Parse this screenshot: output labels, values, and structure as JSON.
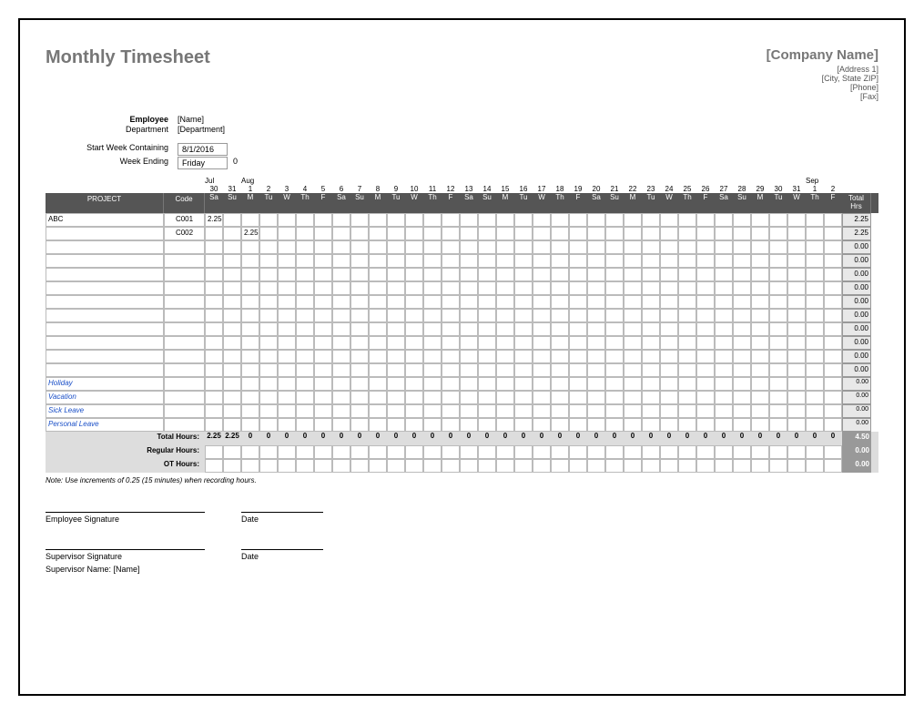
{
  "title": "Monthly Timesheet",
  "company": {
    "name": "[Company Name]",
    "address1": "[Address 1]",
    "city_state_zip": "[City, State ZIP]",
    "phone": "[Phone]",
    "fax": "[Fax]"
  },
  "meta": {
    "employee_label": "Employee",
    "employee_value": "[Name]",
    "department_label": "Department",
    "department_value": "[Department]",
    "start_week_label": "Start Week Containing",
    "start_week_value": "8/1/2016",
    "week_ending_label": "Week Ending",
    "week_ending_value": "Friday",
    "week_ending_num": "0"
  },
  "months": [
    {
      "label": "Jul",
      "at": 0
    },
    {
      "label": "Aug",
      "at": 2
    },
    {
      "label": "Sep",
      "at": 33
    }
  ],
  "dates": [
    "30",
    "31",
    "1",
    "2",
    "3",
    "4",
    "5",
    "6",
    "7",
    "8",
    "9",
    "10",
    "11",
    "12",
    "13",
    "14",
    "15",
    "16",
    "17",
    "18",
    "19",
    "20",
    "21",
    "22",
    "23",
    "24",
    "25",
    "26",
    "27",
    "28",
    "29",
    "30",
    "31",
    "1",
    "2"
  ],
  "days": [
    "Sa",
    "Su",
    "M",
    "Tu",
    "W",
    "Th",
    "F",
    "Sa",
    "Su",
    "M",
    "Tu",
    "W",
    "Th",
    "F",
    "Sa",
    "Su",
    "M",
    "Tu",
    "W",
    "Th",
    "F",
    "Sa",
    "Su",
    "M",
    "Tu",
    "W",
    "Th",
    "F",
    "Sa",
    "Su",
    "M",
    "Tu",
    "W",
    "Th",
    "F"
  ],
  "header": {
    "project": "PROJECT",
    "code": "Code",
    "total_hrs_1": "Total",
    "total_hrs_2": "Hrs"
  },
  "rows": [
    {
      "project": "ABC",
      "code": "C001",
      "cells": {
        "0": "2.25"
      },
      "total": "2.25"
    },
    {
      "project": "",
      "code": "C002",
      "cells": {
        "2": "2.25"
      },
      "total": "2.25"
    },
    {
      "project": "",
      "code": "",
      "cells": {},
      "total": "0.00"
    },
    {
      "project": "",
      "code": "",
      "cells": {},
      "total": "0.00"
    },
    {
      "project": "",
      "code": "",
      "cells": {},
      "total": "0.00"
    },
    {
      "project": "",
      "code": "",
      "cells": {},
      "total": "0.00"
    },
    {
      "project": "",
      "code": "",
      "cells": {},
      "total": "0.00"
    },
    {
      "project": "",
      "code": "",
      "cells": {},
      "total": "0.00"
    },
    {
      "project": "",
      "code": "",
      "cells": {},
      "total": "0.00"
    },
    {
      "project": "",
      "code": "",
      "cells": {},
      "total": "0.00"
    },
    {
      "project": "",
      "code": "",
      "cells": {},
      "total": "0.00"
    },
    {
      "project": "",
      "code": "",
      "cells": {},
      "total": "0.00"
    }
  ],
  "leave_rows": [
    {
      "project": "Holiday",
      "total": "0.00"
    },
    {
      "project": "Vacation",
      "total": "0.00"
    },
    {
      "project": "Sick Leave",
      "total": "0.00"
    },
    {
      "project": "Personal Leave",
      "total": "0.00"
    }
  ],
  "totals": {
    "total_hours_label": "Total Hours:",
    "total_hours": [
      "2.25",
      "2.25",
      "0",
      "0",
      "0",
      "0",
      "0",
      "0",
      "0",
      "0",
      "0",
      "0",
      "0",
      "0",
      "0",
      "0",
      "0",
      "0",
      "0",
      "0",
      "0",
      "0",
      "0",
      "0",
      "0",
      "0",
      "0",
      "0",
      "0",
      "0",
      "0",
      "0",
      "0",
      "0",
      "0"
    ],
    "total_hours_sum": "4.50",
    "regular_hours_label": "Regular Hours:",
    "regular_hours_sum": "0.00",
    "ot_hours_label": "OT Hours:",
    "ot_hours_sum": "0.00"
  },
  "note": "Note: Use increments of 0.25 (15 minutes) when recording hours.",
  "signatures": {
    "emp_sig": "Employee Signature",
    "date": "Date",
    "sup_sig": "Supervisor Signature",
    "sup_name_label": "Supervisor Name:",
    "sup_name_value": "[Name]"
  }
}
